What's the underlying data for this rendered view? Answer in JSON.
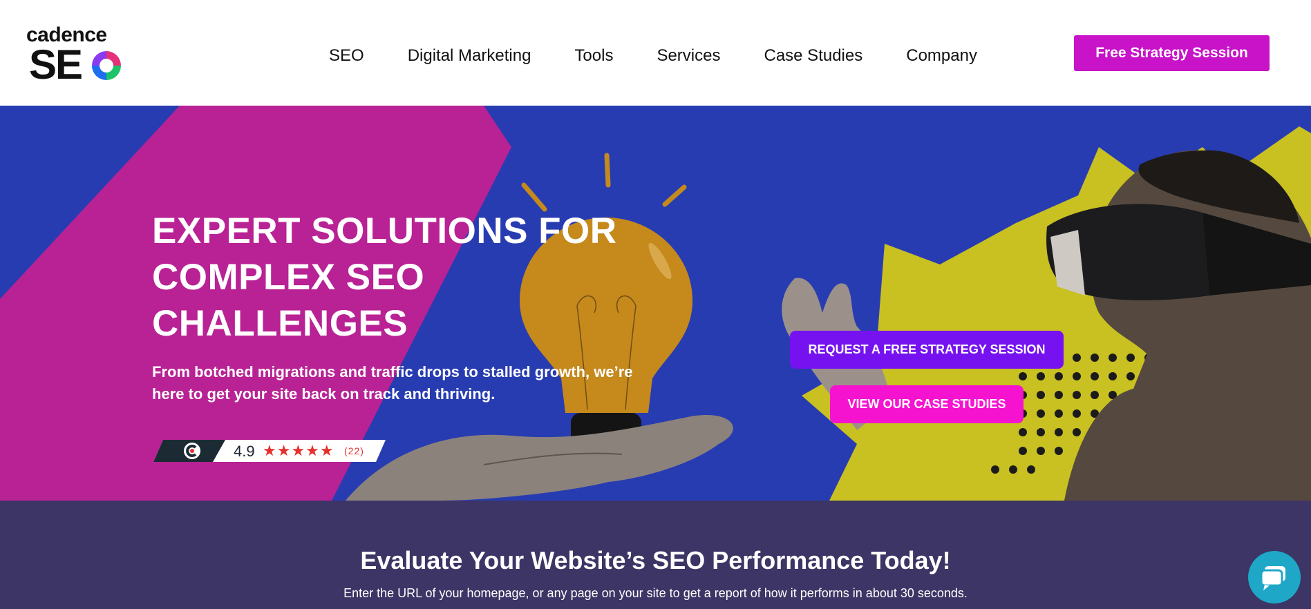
{
  "logo": {
    "line1": "cadence",
    "line2": "SE"
  },
  "nav": {
    "items": [
      {
        "label": "SEO"
      },
      {
        "label": "Digital Marketing"
      },
      {
        "label": "Tools"
      },
      {
        "label": "Services"
      },
      {
        "label": "Case Studies"
      },
      {
        "label": "Company"
      }
    ],
    "cta_label": "Free Strategy Session"
  },
  "hero": {
    "title_lines": [
      "EXPERT SOLUTIONS FOR",
      "COMPLEX SEO",
      "CHALLENGES"
    ],
    "subtitle": "From botched migrations and traffic drops to stalled growth, we’re here to get your site back on track and thriving.",
    "rating": {
      "score": "4.9",
      "stars": "★★★★★",
      "count": "(22)",
      "icon": "c-badge-icon"
    },
    "request_button": "REQUEST A FREE STRATEGY SESSION",
    "view_button": "VIEW OUR CASE STUDIES"
  },
  "evaluate": {
    "title": "Evaluate Your Website’s SEO Performance Today!",
    "subtitle": "Enter the URL of your homepage, or any page on your site to get a report of how it performs in about 30 seconds."
  },
  "chat": {
    "icon": "chat-bubble-icon"
  },
  "colors": {
    "cta_magenta": "#c813c8",
    "hero_blue": "#283cb1",
    "hero_magenta": "#b82294",
    "request_purple": "#7612f0",
    "view_pink": "#f613d0",
    "eval_bg": "#3c3565",
    "chat_teal": "#1fa7c7"
  }
}
